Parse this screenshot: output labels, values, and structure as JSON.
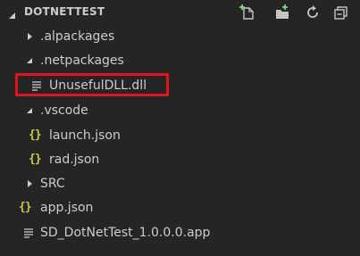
{
  "explorer": {
    "title": "DOTNETTEST",
    "actions": [
      {
        "name": "new-file-icon"
      },
      {
        "name": "new-folder-icon"
      },
      {
        "name": "refresh-icon"
      },
      {
        "name": "collapse-all-icon"
      }
    ],
    "items": [
      {
        "label": ".alpackages",
        "type": "folder",
        "expanded": false
      },
      {
        "label": ".netpackages",
        "type": "folder",
        "expanded": true
      },
      {
        "label": "UnusefulDLL.dll",
        "type": "file",
        "icon": "lines-file-icon"
      },
      {
        "label": ".vscode",
        "type": "folder",
        "expanded": true
      },
      {
        "label": "launch.json",
        "type": "file",
        "icon": "json-icon",
        "icon_glyph": "{}"
      },
      {
        "label": "rad.json",
        "type": "file",
        "icon": "json-icon",
        "icon_glyph": "{}"
      },
      {
        "label": "SRC",
        "type": "folder",
        "expanded": false
      },
      {
        "label": "app.json",
        "type": "file",
        "icon": "json-icon",
        "icon_glyph": "{}"
      },
      {
        "label": "SD_DotNetTest_1.0.0.0.app",
        "type": "file",
        "icon": "lines-file-icon"
      }
    ]
  },
  "colors": {
    "background": "#252526",
    "text": "#cccccc",
    "json_icon": "#cbcb41",
    "highlight_border": "#e0141b"
  }
}
